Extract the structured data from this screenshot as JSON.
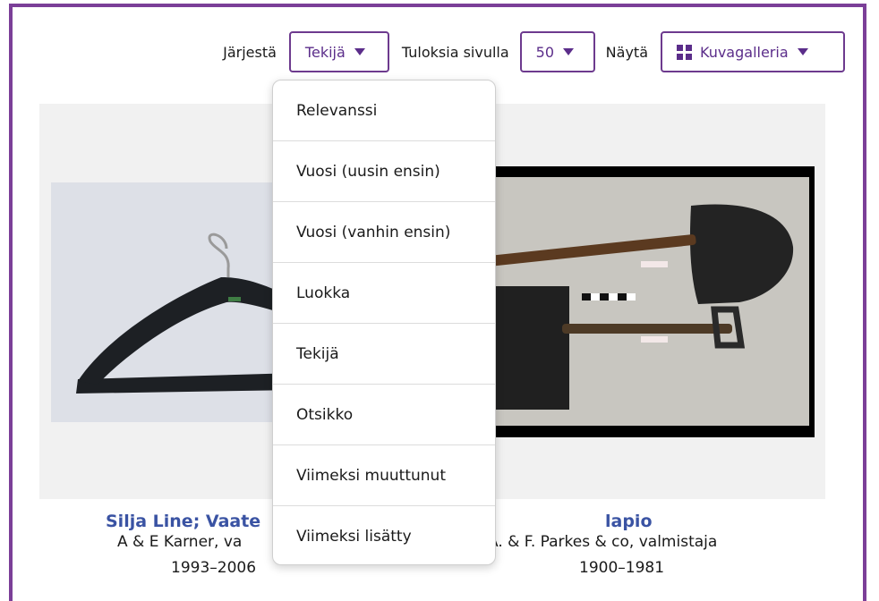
{
  "toolbar": {
    "sort_label": "Järjestä",
    "sort_value": "Tekijä",
    "per_page_label": "Tuloksia sivulla",
    "per_page_value": "50",
    "view_label": "Näytä",
    "view_value": "Kuvagalleria"
  },
  "sort_menu": {
    "options": [
      "Relevanssi",
      "Vuosi (uusin ensin)",
      "Vuosi (vanhin ensin)",
      "Luokka",
      "Tekijä",
      "Otsikko",
      "Viimeksi muuttunut",
      "Viimeksi lisätty"
    ]
  },
  "results": [
    {
      "title": "Silja Line; Vaate",
      "maker": "A & E Karner, va",
      "years": "1993–2006"
    },
    {
      "title": "lapio",
      "maker": "A. & F. Parkes & co, valmistaja",
      "years": "1900–1981"
    }
  ],
  "icons": {
    "view_icon": "grid-icon",
    "caret": "caret-down-icon"
  },
  "colors": {
    "accent": "#7b3f98",
    "link": "#3a53a3"
  }
}
